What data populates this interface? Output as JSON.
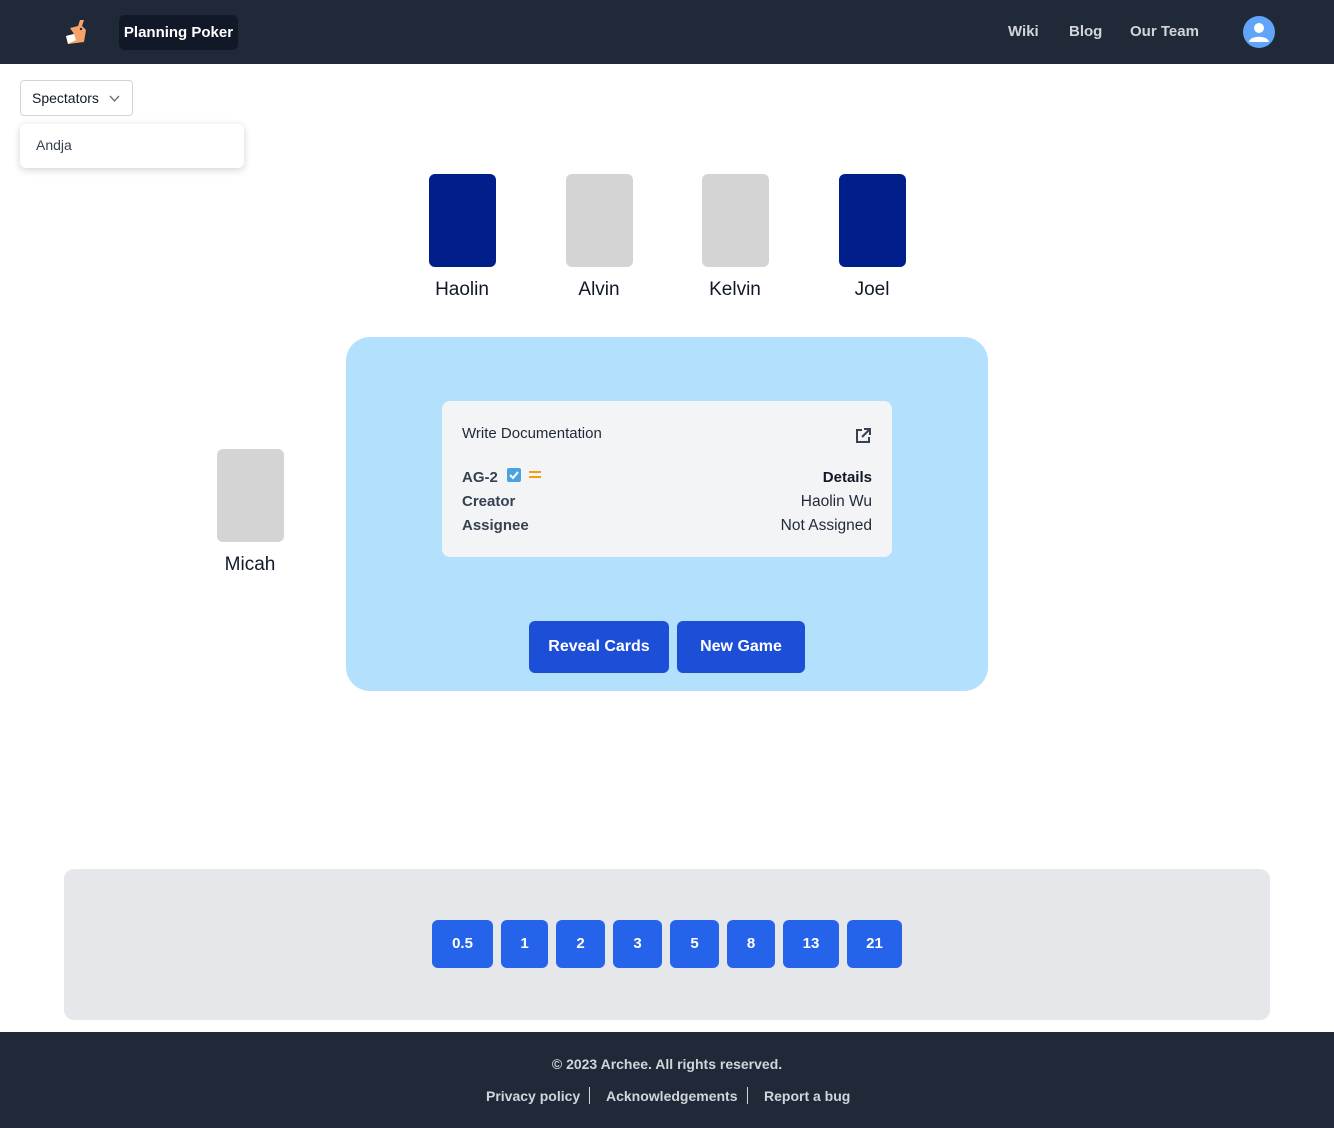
{
  "header": {
    "logo_icon": "fox-logo-icon",
    "brand": "Planning Poker",
    "nav": [
      "Wiki",
      "Blog",
      "Our Team"
    ],
    "avatar_icon": "user-avatar-icon"
  },
  "spectators": {
    "label": "Spectators",
    "items": [
      "Andja"
    ]
  },
  "players": [
    {
      "name": "Haolin",
      "voted": true
    },
    {
      "name": "Alvin",
      "voted": false
    },
    {
      "name": "Kelvin",
      "voted": false
    },
    {
      "name": "Joel",
      "voted": true
    },
    {
      "name": "Micah",
      "voted": false
    }
  ],
  "issue": {
    "title": "Write Documentation",
    "key": "AG-2",
    "details_label": "Details",
    "creator_label": "Creator",
    "creator": "Haolin Wu",
    "assignee_label": "Assignee",
    "assignee": "Not Assigned",
    "type_icon": "task-checkbox-icon",
    "priority_icon": "medium-priority-icon",
    "external_icon": "external-link-icon"
  },
  "actions": {
    "reveal": "Reveal Cards",
    "new_game": "New Game"
  },
  "deck": [
    "0.5",
    "1",
    "2",
    "3",
    "5",
    "8",
    "13",
    "21"
  ],
  "footer": {
    "copyright": "© 2023 Archee. All rights reserved.",
    "links": [
      "Privacy policy",
      "Acknowledgements",
      "Report a bug"
    ]
  },
  "colors": {
    "header_bg": "#1f2937",
    "voted_card": "#001f8a",
    "empty_card": "#d4d4d4",
    "table_bg": "#b3e0fc",
    "action_btn": "#1d4ed8",
    "deck_card": "#2563eb"
  }
}
